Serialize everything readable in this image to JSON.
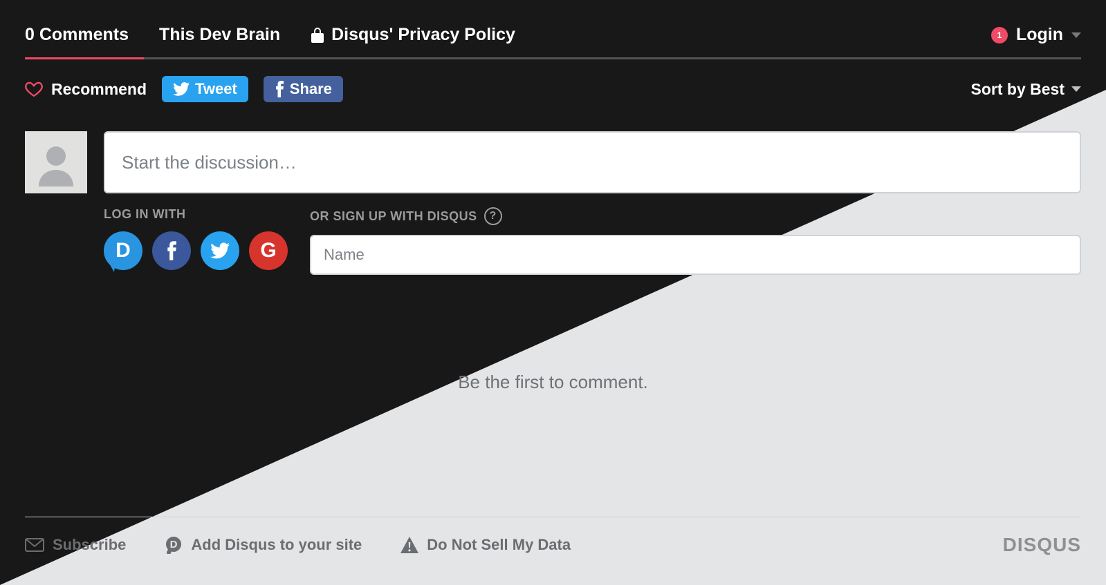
{
  "header": {
    "comments_label": "0 Comments",
    "site_name": "This Dev Brain",
    "privacy_label": "Disqus' Privacy Policy",
    "login_label": "Login",
    "login_badge": "1"
  },
  "actions": {
    "recommend_label": "Recommend",
    "tweet_label": "Tweet",
    "share_label": "Share",
    "sort_label": "Sort by Best"
  },
  "compose": {
    "placeholder": "Start the discussion…"
  },
  "login_with": {
    "header": "LOG IN WITH"
  },
  "signup": {
    "header": "OR SIGN UP WITH DISQUS",
    "name_placeholder": "Name"
  },
  "empty_state": "Be the first to comment.",
  "footer": {
    "subscribe": "Subscribe",
    "add_disqus": "Add Disqus to your site",
    "do_not_sell": "Do Not Sell My Data",
    "brand": "DISQUS"
  },
  "colors": {
    "accent": "#ef4a66",
    "twitter": "#29a3ef",
    "facebook": "#3a589b",
    "google": "#d7342d",
    "disqus": "#2995e0"
  }
}
